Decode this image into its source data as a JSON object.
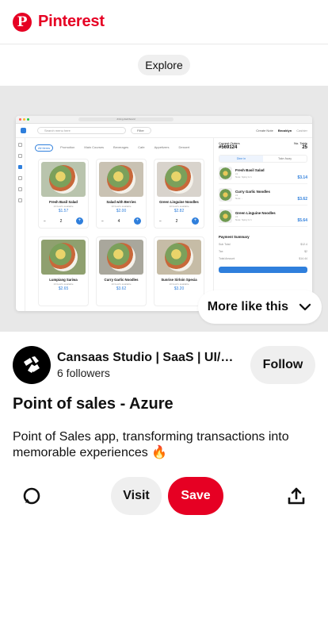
{
  "header": {
    "logo_letter": "P",
    "brand": "Pinterest",
    "brand_color": "#e60023"
  },
  "explore_chip": "Explore",
  "preview": {
    "url": "dining dashboard",
    "search_placeholder": "Search menu here",
    "filter_label": "Filter",
    "create_label": "Create Note",
    "user_name": "Brooklyn",
    "user_role": "Cashier",
    "categories": [
      "All items",
      "Promotion",
      "Main Courses",
      "Beverages",
      "Cafe",
      "Appetizers",
      "Dessert"
    ],
    "products": [
      {
        "name": "Fresh Basil Salad",
        "sub": "13 bowl's available",
        "price": "$1.57",
        "qty": "2"
      },
      {
        "name": "Salad with Berries",
        "sub": "10 bowl's available",
        "price": "$2.00",
        "qty": "4"
      },
      {
        "name": "Green Linguine Noodles",
        "sub": "10 bowl's available",
        "price": "$2.82",
        "qty": "2"
      },
      {
        "name": "Lumpiang Sariwa",
        "sub": "13 bowl's available",
        "price": "$2.65"
      },
      {
        "name": "Curry Garlic Noodles",
        "sub": "10 bowl's available",
        "price": "$3.62"
      },
      {
        "name": "Sunrise Sirloin Specia",
        "sub": "10 bowl's available",
        "price": "$3.20"
      }
    ],
    "order": {
      "label": "Current Orders",
      "number": "#569124",
      "table_label": "No. Table",
      "table": "25",
      "tabs": [
        "Dine in",
        "Take Away"
      ],
      "items": [
        {
          "name": "Fresh Basil Salad",
          "qty": "x1",
          "note": "Note: Spicy lv 1",
          "price": "$3.14"
        },
        {
          "name": "Curry Garlic Noodles",
          "qty": "x1",
          "note": "Note: -",
          "price": "$3.62"
        },
        {
          "name": "Green Linguine Noodles",
          "qty": "x1",
          "note": "Note: Spicy lv 1",
          "price": "$5.64"
        }
      ],
      "summary_title": "Payment Summary",
      "summary": [
        {
          "label": "Sub Total",
          "value": "$12.4"
        },
        {
          "label": "Tax",
          "value": "$2"
        },
        {
          "label": "Total Amount",
          "value": "$14.44"
        }
      ]
    },
    "accent": "#2f7fdc"
  },
  "more_like_this": "More like this",
  "creator": {
    "name": "Cansaas Studio | SaaS | UI/UX...",
    "followers": "6 followers",
    "follow_label": "Follow"
  },
  "pin": {
    "title": "Point of sales - Azure",
    "description": "Point of Sales app, transforming transactions into memorable experiences 🔥"
  },
  "actions": {
    "visit": "Visit",
    "save": "Save"
  }
}
